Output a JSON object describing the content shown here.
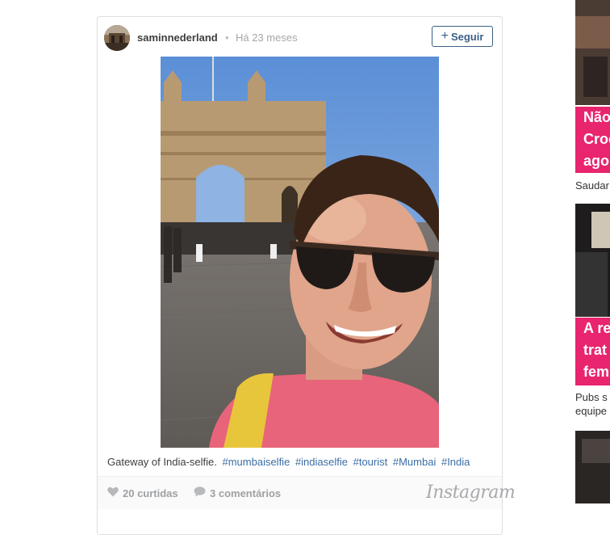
{
  "post": {
    "username": "saminnederland",
    "separator": "•",
    "timestamp": "Há 23 meses",
    "follow_label": "Seguir",
    "caption_text": "Gateway of India-selfie.",
    "hashtags": [
      "#mumbaiselfie",
      "#indiaselfie",
      "#tourist",
      "#Mumbai",
      "#India"
    ],
    "likes": "20 curtidas",
    "comments": "3 comentários",
    "brand": "Instagram"
  },
  "rail": {
    "story1": {
      "headline_lines": [
        "Não",
        "Croc",
        "ago"
      ],
      "subtext": "Saudar"
    },
    "story2": {
      "headline_lines": [
        "A re",
        "trat",
        "fem"
      ],
      "subtext_lines": [
        "Pubs s",
        "equipe"
      ]
    }
  },
  "colors": {
    "accent_pink": "#e8256e",
    "link_blue": "#3b6ea5",
    "follow_blue": "#3b5f86"
  },
  "icons": {
    "like": "heart-icon",
    "comment": "speech-bubble-icon",
    "follow": "plus-icon"
  }
}
